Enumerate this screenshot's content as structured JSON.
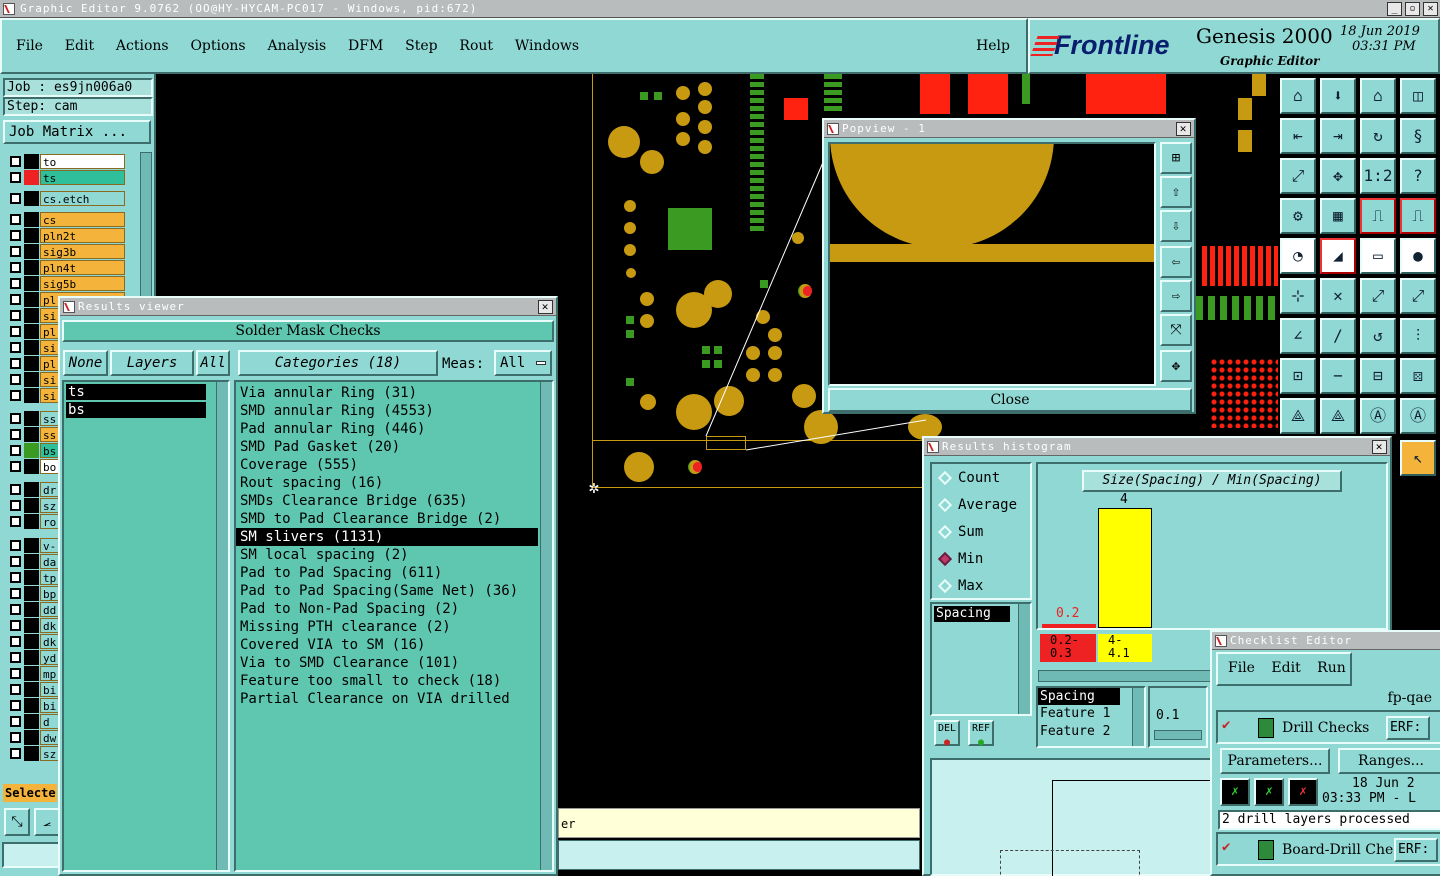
{
  "window": {
    "title": "Graphic Editor 9.0762 (OO@HY-HYCAM-PC017 - Windows, pid:672)"
  },
  "menu": {
    "items": [
      "File",
      "Edit",
      "Actions",
      "Options",
      "Analysis",
      "DFM",
      "Step",
      "Rout",
      "Windows"
    ],
    "help": "Help"
  },
  "brand": {
    "logo": "Frontline",
    "product": "Genesis 2000",
    "subtitle": "Graphic Editor",
    "date": "18 Jun 2019",
    "time": "03:31 PM"
  },
  "job": {
    "job_label": "Job : es9jn006a0",
    "step_label": "Step: cam",
    "matrix_button": "Job Matrix ..."
  },
  "layers": [
    {
      "name": "to",
      "color": "#ffffff"
    },
    {
      "name": "ts",
      "color": "#2fbf9a"
    },
    {
      "name": "cs.etch",
      "color": "#8fd8d4"
    },
    {
      "name": "cs",
      "color": "#f4b43c"
    },
    {
      "name": "pln2t",
      "color": "#f4b43c"
    },
    {
      "name": "sig3b",
      "color": "#f4b43c"
    },
    {
      "name": "pln4t",
      "color": "#f4b43c"
    },
    {
      "name": "sig5b",
      "color": "#f4b43c"
    },
    {
      "name": "pl",
      "color": "#f4b43c"
    },
    {
      "name": "si",
      "color": "#f4b43c"
    },
    {
      "name": "pl",
      "color": "#f4b43c"
    },
    {
      "name": "si",
      "color": "#f4b43c"
    },
    {
      "name": "pl",
      "color": "#f4b43c"
    },
    {
      "name": "si",
      "color": "#f4b43c"
    },
    {
      "name": "si",
      "color": "#f4b43c"
    },
    {
      "name": "ss",
      "color": "#8fd8d4"
    },
    {
      "name": "ss",
      "color": "#f4b43c"
    },
    {
      "name": "bs",
      "color": "#2fbf9a"
    },
    {
      "name": "bo",
      "color": "#ffffff"
    },
    {
      "name": "dr",
      "color": "#8fd8d4"
    },
    {
      "name": "sz",
      "color": "#8fd8d4"
    },
    {
      "name": "ro",
      "color": "#8fd8d4"
    },
    {
      "name": "v-",
      "color": "#8fd8d4"
    },
    {
      "name": "da",
      "color": "#8fd8d4"
    },
    {
      "name": "tp",
      "color": "#8fd8d4"
    },
    {
      "name": "bp",
      "color": "#8fd8d4"
    },
    {
      "name": "dd",
      "color": "#8fd8d4"
    },
    {
      "name": "dk",
      "color": "#8fd8d4"
    },
    {
      "name": "dk",
      "color": "#8fd8d4"
    },
    {
      "name": "yd",
      "color": "#8fd8d4"
    },
    {
      "name": "mp",
      "color": "#8fd8d4"
    },
    {
      "name": "bi",
      "color": "#8fd8d4"
    },
    {
      "name": "bi",
      "color": "#8fd8d4"
    },
    {
      "name": "d",
      "color": "#8fd8d4"
    },
    {
      "name": "dw",
      "color": "#8fd8d4"
    },
    {
      "name": "sz",
      "color": "#8fd8d4"
    }
  ],
  "selected_label": "Selecte",
  "results_viewer": {
    "title": "Results viewer",
    "header": "Solder Mask Checks",
    "none_button": "None",
    "layers_button": "Layers",
    "all_button": "All",
    "categories_button": "Categories (18)",
    "meas_label": "Meas:",
    "meas_value": "All",
    "layer_list": [
      "ts",
      "bs"
    ],
    "categories": [
      "Via annular Ring (31)",
      "SMD annular Ring (4553)",
      "Pad annular Ring (446)",
      "SMD Pad Gasket (20)",
      "Coverage (555)",
      "Rout spacing (16)",
      "SMDs Clearance Bridge (635)",
      "SMD to Pad Clearance Bridge (2)",
      "SM slivers (1131)",
      "SM local spacing (2)",
      "Pad to Pad Spacing (611)",
      "Pad to Pad Spacing(Same Net) (36)",
      "Pad to Non-Pad Spacing (2)",
      "Missing PTH clearance (2)",
      "Covered VIA to SM (16)",
      "Via to SMD Clearance (101)",
      "Feature too small to check (18)",
      "Partial Clearance on VIA drilled"
    ],
    "selected_index": 8
  },
  "popview": {
    "title": "Popview - 1",
    "close_button": "Close"
  },
  "histogram": {
    "title": "Results histogram",
    "chart_title": "Size(Spacing) / Min(Spacing)",
    "modes": [
      "Count",
      "Average",
      "Sum",
      "Min",
      "Max"
    ],
    "selected_mode": "Min",
    "list": [
      "Spacing"
    ],
    "del_label": "DEL",
    "ref_label": "REF",
    "bar_labels": [
      "0.2",
      "4"
    ],
    "bin_labels": [
      "0.2-\n0.3",
      "4-\n4.1"
    ],
    "features": [
      "Spacing",
      "Feature 1",
      "Feature 2"
    ],
    "slider_value": "0.1"
  },
  "checklist": {
    "title": "Checklist Editor",
    "menu": [
      "File",
      "Edit",
      "Run"
    ],
    "name": "fp-qae",
    "rows": [
      {
        "name": "Drill Checks",
        "erf": "ERF:"
      },
      {
        "name": "Board-Drill Che",
        "erf": "ERF:"
      }
    ],
    "params_button": "Parameters...",
    "ranges_button": "Ranges...",
    "run_date": "18 Jun 2",
    "run_time": "03:33 PM - L",
    "status": "2 drill layers processed"
  },
  "bottom": {
    "message_fragment": "er"
  }
}
